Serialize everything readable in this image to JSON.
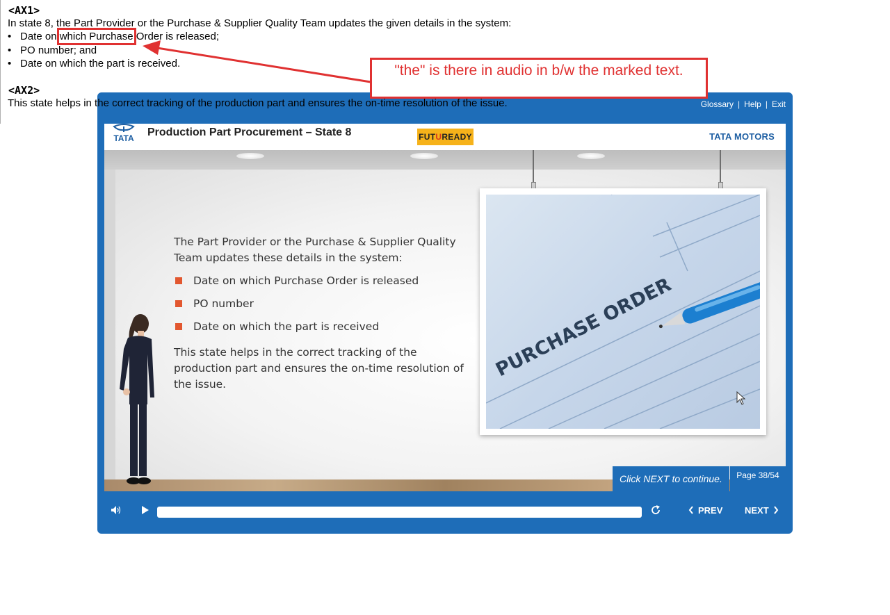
{
  "notes": {
    "ax1_tag": "<AX1>",
    "ax1_intro": "In state 8, the Part Provider or the  Purchase & Supplier Quality Team updates the given details in the system:",
    "bullet_dot": "•",
    "bullet1_before": "Date on ",
    "bullet1_highlight": "which Purchase",
    "bullet1_after": " Order is released;",
    "bullet2": "PO number; and",
    "bullet3": "Date on which the part is received.",
    "ax2_tag": "<AX2>",
    "ax2_text": "This state helps in the correct tracking of the production part and ensures the on-time resolution of the issue."
  },
  "callout": {
    "text": "\"the\" is there in audio in b/w the marked text.",
    "color": "#e03131"
  },
  "player": {
    "util_nav": {
      "glossary": "Glossary",
      "help": "Help",
      "exit": "Exit",
      "sep": "|"
    },
    "header": {
      "tata_mark": "TATA",
      "title": "Production Part Procurement – State 8",
      "futuready_pre": "FUT",
      "futuready_u": "U",
      "futuready_post": "READY",
      "brand": "TATA MOTORS"
    },
    "slide": {
      "intro": "The Part Provider or the Purchase & Supplier Quality Team updates these details in the system:",
      "bullets": [
        "Date on which Purchase Order is released",
        "PO number",
        "Date on which the part is received"
      ],
      "outro": "This state helps in the correct tracking of the production part and ensures the on-time resolution of the issue.",
      "photo_text": "PURCHASE ORDER"
    },
    "continue_text": "Click NEXT to continue.",
    "page_indicator": "Page 38/54",
    "controls": {
      "prev": "PREV",
      "next": "NEXT",
      "progress": 0
    },
    "colors": {
      "frame": "#1e6db8",
      "bullet": "#e2572f",
      "futuready": "#f6b21a"
    }
  }
}
